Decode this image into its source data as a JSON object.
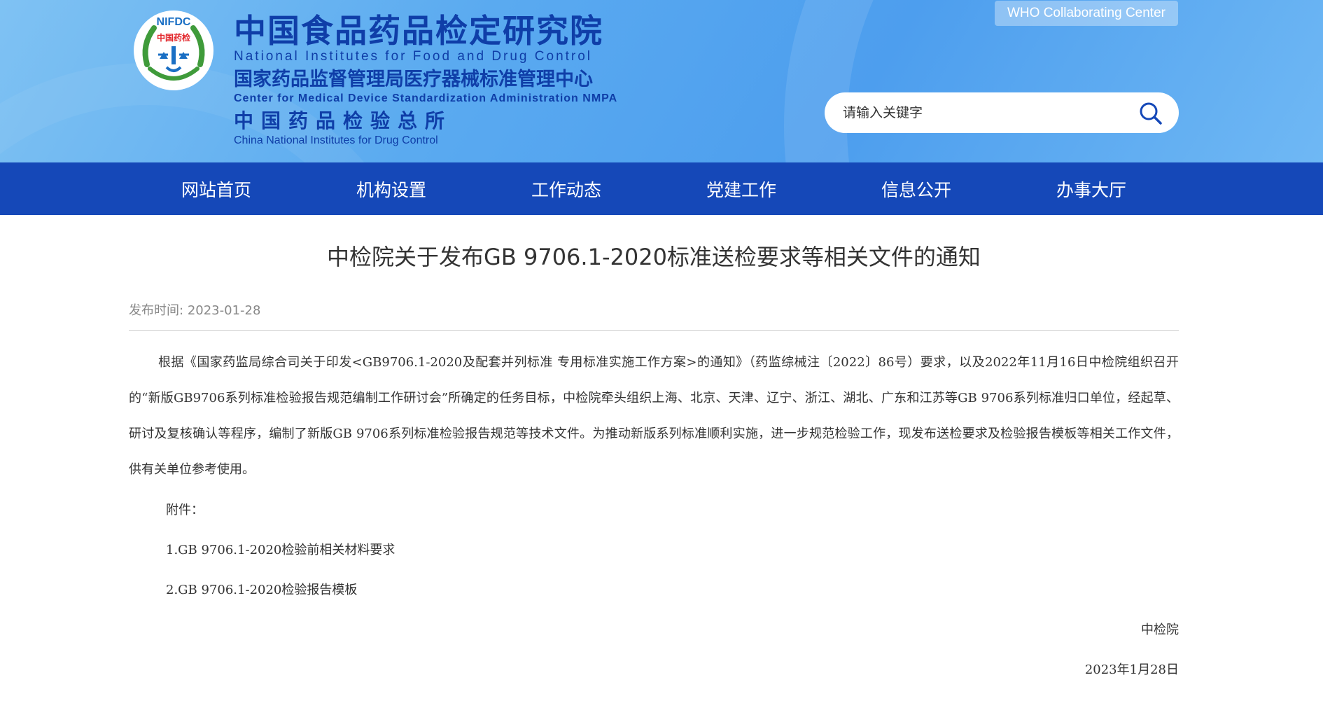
{
  "header": {
    "logo": {
      "top_text": "NIFDC",
      "center_text": "中国药检",
      "icon": "nifdc-logo-emblem"
    },
    "title_cn": "中国食品药品检定研究院",
    "title_en": "National Institutes for Food and Drug Control",
    "subtitle_cn": "国家药品监督管理局医疗器械标准管理中心",
    "subtitle_en": "Center for Medical Device Standardization Administration NMPA",
    "subtitle2_cn": "中国药品检验总所",
    "subtitle2_en": "China National Institutes for Drug Control",
    "who_link": "WHO Collaborating Center",
    "search": {
      "placeholder": "请输入关键字",
      "icon": "search-icon"
    }
  },
  "nav": {
    "items": [
      {
        "label": "网站首页"
      },
      {
        "label": "机构设置"
      },
      {
        "label": "工作动态"
      },
      {
        "label": "党建工作"
      },
      {
        "label": "信息公开"
      },
      {
        "label": "办事大厅"
      }
    ]
  },
  "article": {
    "title": "中检院关于发布GB 9706.1-2020标准送检要求等相关文件的通知",
    "publish_label": "发布时间:",
    "publish_date": "2023-01-28",
    "body": "根据《国家药监局综合司关于印发<GB9706.1-2020及配套并列标准 专用标准实施工作方案>的通知》（药监综械注〔2022〕86号）要求，以及2022年11月16日中检院组织召开的“新版GB9706系列标准检验报告规范编制工作研讨会”所确定的任务目标，中检院牵头组织上海、北京、天津、辽宁、浙江、湖北、广东和江苏等GB 9706系列标准归口单位，经起草、研讨及复核确认等程序，编制了新版GB 9706系列标准检验报告规范等技术文件。为推动新版系列标准顺利实施，进一步规范检验工作，现发布送检要求及检验报告模板等相关工作文件，供有关单位参考使用。",
    "attachment_label": "附件：",
    "attachments": [
      "1.GB 9706.1-2020检验前相关材料要求",
      "2.GB 9706.1-2020检验报告模板"
    ],
    "signature": "中检院",
    "sign_date": "2023年1月28日"
  },
  "colors": {
    "header_blue": "#5aaaf0",
    "nav_blue": "#1548b8",
    "title_blue": "#0f3ea8",
    "logo_green": "#3f9b3a",
    "logo_red": "#e2262b"
  }
}
